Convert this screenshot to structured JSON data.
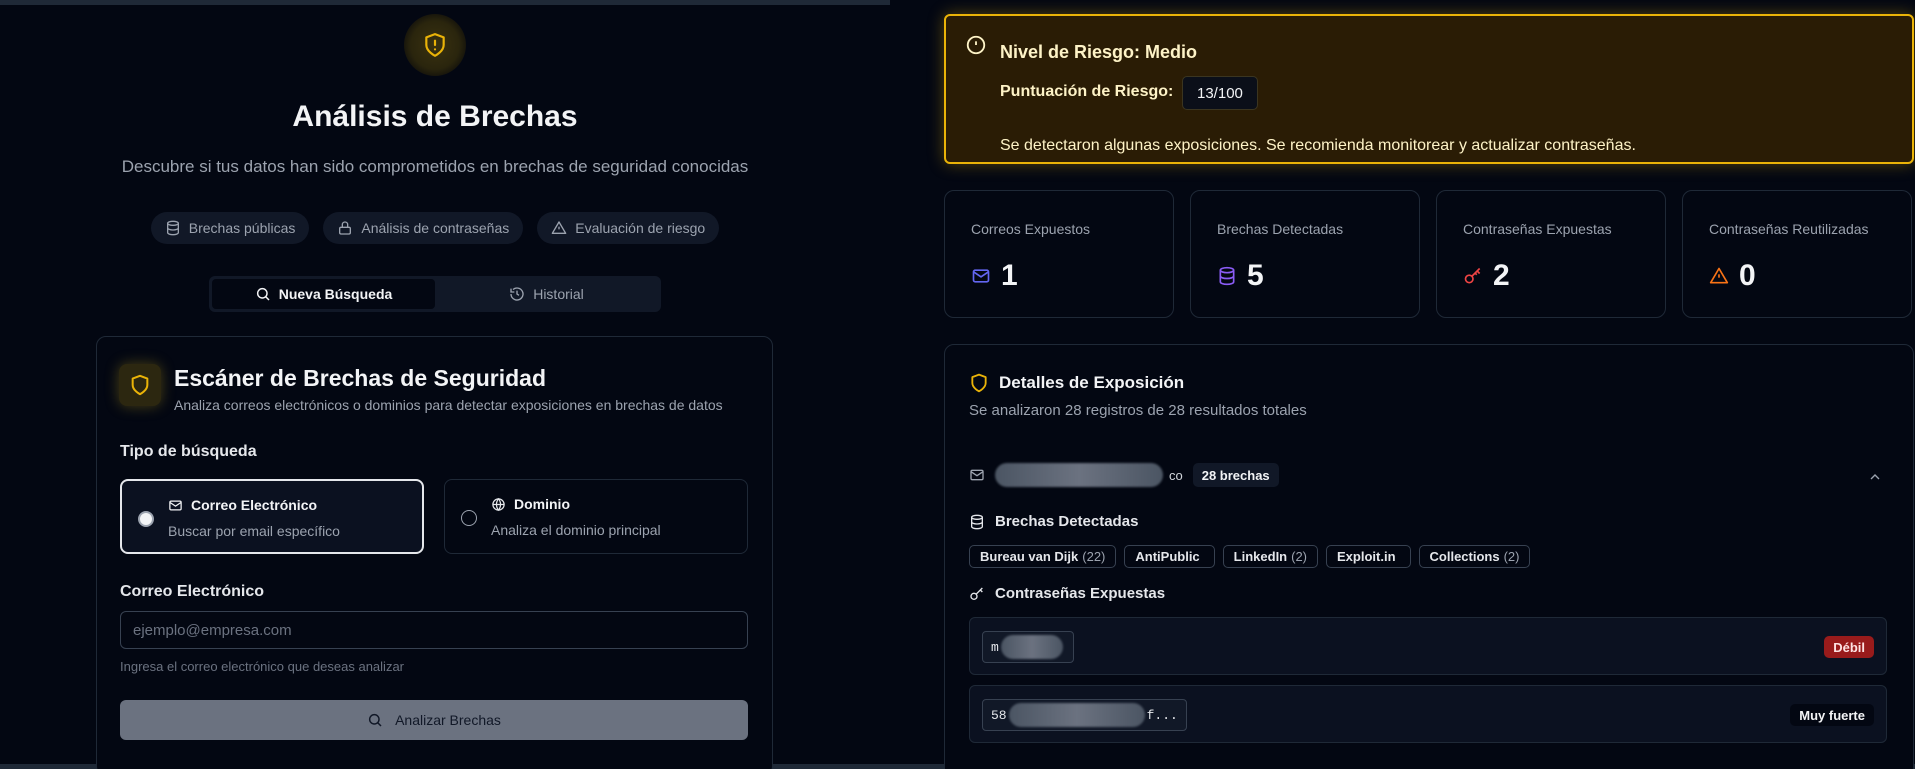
{
  "left": {
    "title": "Análisis de Brechas",
    "subtitle": "Descubre si tus datos han sido comprometidos en brechas de seguridad conocidas",
    "chips": [
      {
        "label": "Brechas públicas",
        "icon": "database-icon"
      },
      {
        "label": "Análisis de contraseñas",
        "icon": "lock-icon"
      },
      {
        "label": "Evaluación de riesgo",
        "icon": "warning-icon"
      }
    ],
    "tabs": [
      {
        "label": "Nueva Búsqueda",
        "icon": "search-icon",
        "active": true
      },
      {
        "label": "Historial",
        "icon": "history-icon",
        "active": false
      }
    ],
    "scanner": {
      "title": "Escáner de Brechas de Seguridad",
      "description": "Analiza correos electrónicos o dominios para detectar exposiciones en brechas de datos",
      "search_type_label": "Tipo de búsqueda",
      "options": [
        {
          "title": "Correo Electrónico",
          "subtitle": "Buscar por email específico",
          "icon": "mail-icon",
          "selected": true
        },
        {
          "title": "Dominio",
          "subtitle": "Analiza el dominio principal",
          "icon": "globe-icon",
          "selected": false
        }
      ],
      "email_label": "Correo Electrónico",
      "email_placeholder": "ejemplo@empresa.com",
      "email_value": "",
      "helper": "Ingresa el correo electrónico que deseas analizar",
      "analyze_button": "Analizar Brechas"
    }
  },
  "right": {
    "risk": {
      "title": "Nivel de Riesgo: Medio",
      "score_label": "Puntuación de Riesgo:",
      "score": "13/100",
      "message": "Se detectaron algunas exposiciones. Se recomienda monitorear y actualizar contraseñas.",
      "color": "#eab308"
    },
    "stats": [
      {
        "label": "Correos Expuestos",
        "value": "1",
        "icon": "mail-icon",
        "color": "#6366f1"
      },
      {
        "label": "Brechas Detectadas",
        "value": "5",
        "icon": "database-icon",
        "color": "#8b5cf6"
      },
      {
        "label": "Contraseñas Expuestas",
        "value": "2",
        "icon": "key-icon",
        "color": "#ef4444"
      },
      {
        "label": "Contraseñas Reutilizadas",
        "value": "0",
        "icon": "warning-icon",
        "color": "#f97316"
      }
    ],
    "details": {
      "title": "Detalles de Exposición",
      "subtitle": "Se analizaron 28 registros de 28 resultados totales",
      "email_suffix": "co",
      "breach_count": "28 brechas",
      "breaches_heading": "Brechas Detectadas",
      "breaches": [
        {
          "name": "Bureau van Dijk",
          "count": "(22)"
        },
        {
          "name": "AntiPublic",
          "count": ""
        },
        {
          "name": "LinkedIn",
          "count": "(2)"
        },
        {
          "name": "Exploit.in",
          "count": ""
        },
        {
          "name": "Collections",
          "count": "(2)"
        }
      ],
      "passwords_heading": "Contraseñas Expuestas",
      "passwords": [
        {
          "prefix": "m",
          "suffix": "",
          "strength": "Débil"
        },
        {
          "prefix": "58",
          "suffix": "f...",
          "strength": "Muy fuerte"
        }
      ]
    }
  }
}
